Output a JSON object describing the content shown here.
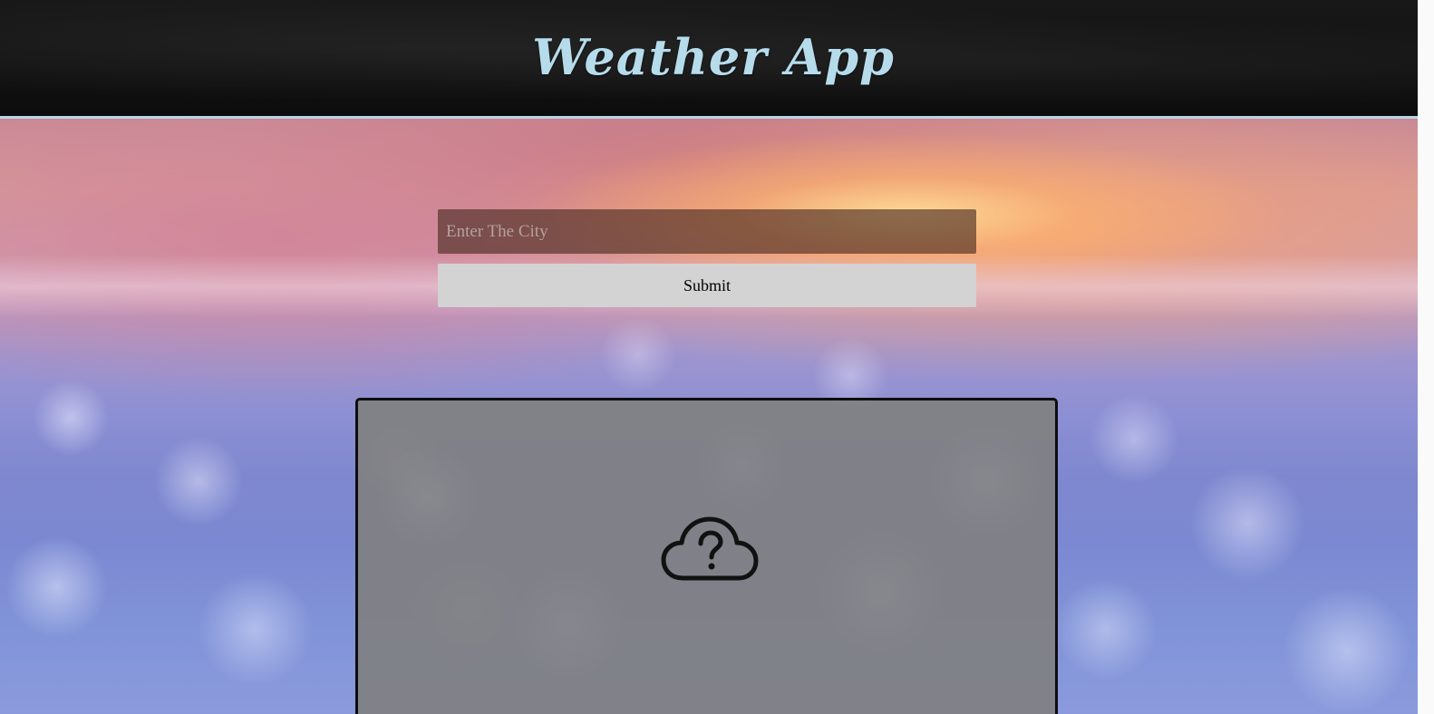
{
  "header": {
    "title": "Weather App"
  },
  "search": {
    "placeholder": "Enter The City",
    "value": ""
  },
  "form": {
    "submit_label": "Submit"
  },
  "result": {
    "icon": "cloud-question-icon"
  },
  "colors": {
    "title": "#b6dcec",
    "header_bg": "#141414",
    "submit_bg": "#d3d3d3",
    "card_bg": "#808082"
  }
}
